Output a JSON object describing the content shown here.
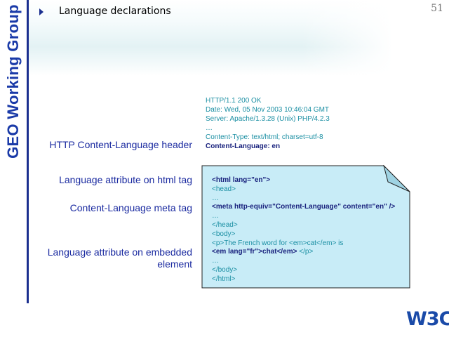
{
  "sidebar": {
    "group_title": "GEO Working Group"
  },
  "slide": {
    "title": "Language declarations",
    "page_number": "51"
  },
  "labels": {
    "http_header": "HTTP Content-Language header",
    "html_tag": "Language attribute on html tag",
    "meta_tag": "Content-Language meta tag",
    "embedded_line1": "Language attribute on embedded",
    "embedded_line2": "element"
  },
  "http_response": [
    {
      "text": "HTTP/1.1 200 OK",
      "highlight": false
    },
    {
      "text": "Date: Wed, 05 Nov 2003 10:46:04 GMT",
      "highlight": false
    },
    {
      "text": "Server: Apache/1.3.28 (Unix) PHP/4.2.3",
      "highlight": false
    },
    {
      "text": "…",
      "highlight": false
    },
    {
      "text": "Content-Type: text/html; charset=utf-8",
      "highlight": false
    },
    {
      "text": "Content-Language: en",
      "highlight": true
    }
  ],
  "code_lines": [
    {
      "text": "<html lang=\"en\">",
      "highlight": true
    },
    {
      "text": "<head>",
      "highlight": false
    },
    {
      "text": "…",
      "highlight": false
    },
    {
      "text": "<meta http-equiv=\"Content-Language\" content=\"en\" />",
      "highlight": true
    },
    {
      "text": "…",
      "highlight": false
    },
    {
      "text": "</head>",
      "highlight": false
    },
    {
      "text": "<body>",
      "highlight": false
    },
    {
      "text": "<p>The French word for <em>cat</em> is",
      "highlight": false
    },
    {
      "text": "<em lang=\"fr\">chat</em>",
      "highlight": true,
      "suffix": " </p>"
    },
    {
      "text": "…",
      "highlight": false
    },
    {
      "text": "</body>",
      "highlight": false
    },
    {
      "text": "</html>",
      "highlight": false
    }
  ],
  "logo": {
    "text": "W3C",
    "reg": "®"
  },
  "colors": {
    "sidebar_title": "#1a3aa8",
    "label": "#1a2aa0",
    "code_teal": "#1b8fa3",
    "code_highlight": "#1a237e",
    "code_box_fill": "#c8ecf7"
  }
}
